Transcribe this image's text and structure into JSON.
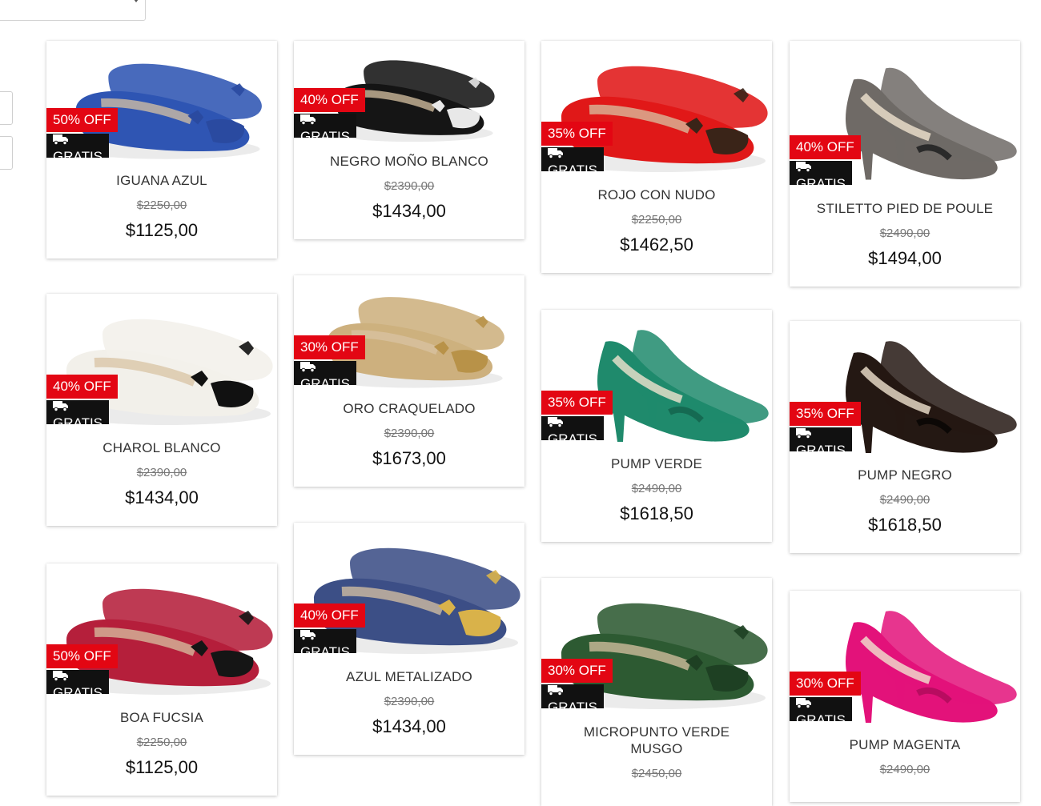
{
  "shipping_label": "GRATIS",
  "colors": {
    "badge_red": "#e30613",
    "badge_black": "#111111"
  },
  "icons": {
    "shipping": "truck-icon"
  },
  "products": [
    {
      "name": "IGUANA AZUL",
      "discount": "50% OFF",
      "old_price": "$2250,00",
      "price": "$1125,00",
      "shoe": "flat",
      "color": "#2f55b3",
      "trim": "#2a4aa0"
    },
    {
      "name": "NEGRO MOÑO BLANCO",
      "discount": "40% OFF",
      "old_price": "$2390,00",
      "price": "$1434,00",
      "shoe": "flat",
      "color": "#151515",
      "trim": "#e8e8e8"
    },
    {
      "name": "ROJO CON NUDO",
      "discount": "35% OFF",
      "old_price": "$2250,00",
      "price": "$1462,50",
      "shoe": "flat",
      "color": "#e01818",
      "trim": "#3a2418"
    },
    {
      "name": "STILETTO PIED DE POULE",
      "discount": "40% OFF",
      "old_price": "$2490,00",
      "price": "$1494,00",
      "shoe": "pump",
      "color": "#6f6a66",
      "trim": "#2a2a2a"
    },
    {
      "name": "CHAROL BLANCO",
      "discount": "40% OFF",
      "old_price": "$2390,00",
      "price": "$1434,00",
      "shoe": "flat",
      "color": "#f2f0ea",
      "trim": "#111111"
    },
    {
      "name": "ORO CRAQUELADO",
      "discount": "30% OFF",
      "old_price": "$2390,00",
      "price": "$1673,00",
      "shoe": "flat",
      "color": "#cdb07e",
      "trim": "#b89248"
    },
    {
      "name": "PUMP VERDE",
      "discount": "35% OFF",
      "old_price": "$2490,00",
      "price": "$1618,50",
      "shoe": "pump",
      "color": "#1f8a6c",
      "trim": "#156a52"
    },
    {
      "name": "PUMP NEGRO",
      "discount": "35% OFF",
      "old_price": "$2490,00",
      "price": "$1618,50",
      "shoe": "pump",
      "color": "#241813",
      "trim": "#0c0806"
    },
    {
      "name": "BOA FUCSIA",
      "discount": "50% OFF",
      "old_price": "$2250,00",
      "price": "$1125,00",
      "shoe": "flat",
      "color": "#b51f3b",
      "trim": "#151515"
    },
    {
      "name": "AZUL METALIZADO",
      "discount": "40% OFF",
      "old_price": "$2390,00",
      "price": "$1434,00",
      "shoe": "flat",
      "color": "#3c4f86",
      "trim": "#d9b24a"
    },
    {
      "name": "MICROPUNTO VERDE MUSGO",
      "discount": "30% OFF",
      "old_price": "$2450,00",
      "price": "",
      "shoe": "flat",
      "color": "#2d5a32",
      "trim": "#1e4023"
    },
    {
      "name": "PUMP MAGENTA",
      "discount": "30% OFF",
      "old_price": "$2490,00",
      "price": "",
      "shoe": "pump",
      "color": "#e3127a",
      "trim": "#b80c60"
    }
  ]
}
